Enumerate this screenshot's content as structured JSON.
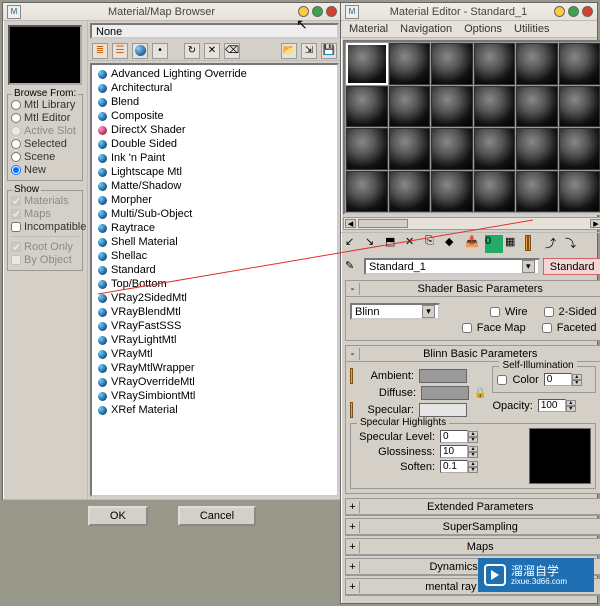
{
  "browser": {
    "title": "Material/Map Browser",
    "none_label": "None",
    "browse_from": {
      "title": "Browse From:",
      "items": [
        {
          "label": "Mtl Library",
          "checked": false,
          "enabled": true
        },
        {
          "label": "Mtl Editor",
          "checked": false,
          "enabled": true
        },
        {
          "label": "Active Slot",
          "checked": false,
          "enabled": false
        },
        {
          "label": "Selected",
          "checked": false,
          "enabled": true
        },
        {
          "label": "Scene",
          "checked": false,
          "enabled": true
        },
        {
          "label": "New",
          "checked": true,
          "enabled": true
        }
      ]
    },
    "show": {
      "title": "Show",
      "items": [
        {
          "label": "Materials",
          "checked": true,
          "enabled": false
        },
        {
          "label": "Maps",
          "checked": true,
          "enabled": false
        },
        {
          "label": "Incompatible",
          "checked": false,
          "enabled": true
        }
      ],
      "items2": [
        {
          "label": "Root Only",
          "checked": true,
          "enabled": false
        },
        {
          "label": "By Object",
          "checked": false,
          "enabled": false
        }
      ]
    },
    "materials": [
      "Advanced Lighting Override",
      "Architectural",
      "Blend",
      "Composite",
      "DirectX Shader",
      "Double Sided",
      "Ink 'n Paint",
      "Lightscape Mtl",
      "Matte/Shadow",
      "Morpher",
      "Multi/Sub-Object",
      "Raytrace",
      "Shell Material",
      "Shellac",
      "Standard",
      "Top/Bottom",
      "VRay2SidedMtl",
      "VRayBlendMtl",
      "VRayFastSSS",
      "VRayLightMtl",
      "VRayMtl",
      "VRayMtlWrapper",
      "VRayOverrideMtl",
      "VRaySimbiontMtl",
      "XRef Material"
    ],
    "ok": "OK",
    "cancel": "Cancel"
  },
  "editor": {
    "title": "Material Editor - Standard_1",
    "menu": [
      "Material",
      "Navigation",
      "Options",
      "Utilities"
    ],
    "name_field": "Standard_1",
    "type_button": "Standard",
    "rollouts": {
      "shader_basic": {
        "title": "Shader Basic Parameters",
        "shader": "Blinn",
        "wire": "Wire",
        "two_sided": "2-Sided",
        "face_map": "Face Map",
        "faceted": "Faceted"
      },
      "blinn_basic": {
        "title": "Blinn Basic Parameters",
        "self_illum": "Self-Illumination",
        "color_chk": "Color",
        "color_val": "0",
        "ambient": "Ambient:",
        "diffuse": "Diffuse:",
        "specular": "Specular:",
        "opacity": "Opacity:",
        "opacity_val": "100",
        "spec_hl": {
          "title": "Specular Highlights",
          "level": "Specular Level:",
          "level_val": "0",
          "gloss": "Glossiness:",
          "gloss_val": "10",
          "soften": "Soften:",
          "soften_val": "0.1"
        }
      },
      "collapsed": [
        "Extended Parameters",
        "SuperSampling",
        "Maps",
        "Dynamics Properties",
        "mental ray Connection"
      ]
    }
  },
  "watermark": {
    "brand": "溜溜自学",
    "url": "zixue.3d66.com"
  }
}
